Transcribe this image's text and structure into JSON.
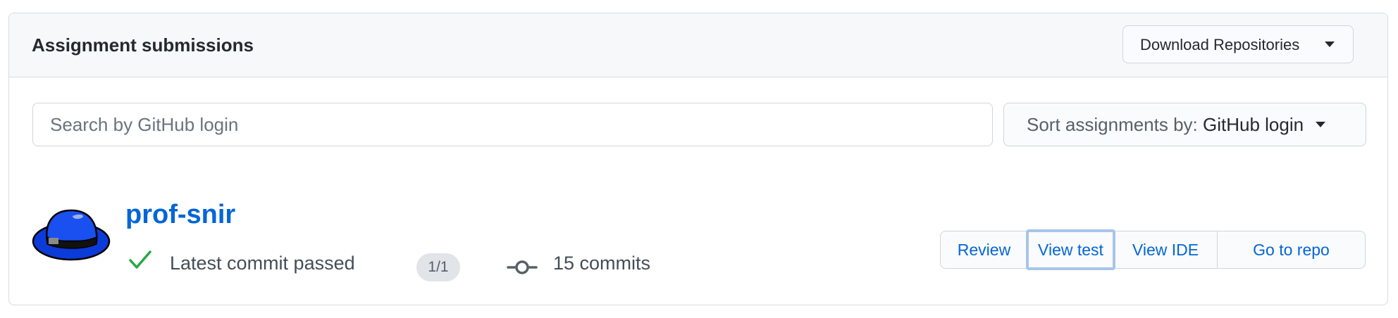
{
  "panel": {
    "title": "Assignment submissions",
    "download_button_label": "Download Repositories"
  },
  "search": {
    "placeholder": "Search by GitHub login",
    "value": ""
  },
  "sort": {
    "prefix": "Sort assignments by:",
    "value": "GitHub login"
  },
  "submission": {
    "username": "prof-snir",
    "avatar_icon": "blue-fedora-hat-icon",
    "status_icon": "check-icon",
    "status_text": "Latest commit passed",
    "score": "1/1",
    "commit_icon": "git-commit-icon",
    "commits_text": "15 commits",
    "actions": {
      "review": "Review",
      "view_test": "View test",
      "view_ide": "View IDE",
      "go_to_repo": "Go to repo"
    },
    "focused_action": "view_test"
  },
  "colors": {
    "link": "#0366d6",
    "success": "#28a745",
    "header_bg": "#f6f8fa",
    "focus_ring": "#a7c5eb"
  }
}
